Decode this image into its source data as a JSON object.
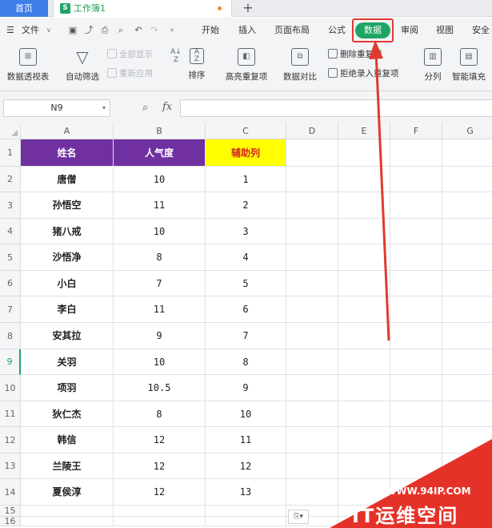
{
  "tabs": {
    "home": "首页",
    "workbook": "工作簿1",
    "new_tab": "+"
  },
  "menu": {
    "file": "文件",
    "items": [
      "开始",
      "插入",
      "页面布局",
      "公式",
      "数据",
      "审阅",
      "视图",
      "安全"
    ]
  },
  "ribbon": {
    "pivot": "数据透视表",
    "autofilter": "自动筛选",
    "show_all": "全部显示",
    "reapply": "重新应用",
    "sort": "排序",
    "highlight_dup": "高亮重复项",
    "compare": "数据对比",
    "remove_dup": "删除重复项",
    "reject_dup": "拒绝录入重复项",
    "split": "分列",
    "smart_fill": "智能填充"
  },
  "formula_bar": {
    "name_box": "N9",
    "fx": "fx",
    "formula": ""
  },
  "columns": [
    "A",
    "B",
    "C",
    "D",
    "E",
    "F",
    "G"
  ],
  "rows": [
    "1",
    "2",
    "3",
    "4",
    "5",
    "6",
    "7",
    "8",
    "9",
    "10",
    "11",
    "12",
    "13",
    "14",
    "15",
    "16"
  ],
  "active_row": "9",
  "headers": [
    "姓名",
    "人气度",
    "辅助列"
  ],
  "table": [
    [
      "唐僧",
      "10",
      "1"
    ],
    [
      "孙悟空",
      "11",
      "2"
    ],
    [
      "猪八戒",
      "10",
      "3"
    ],
    [
      "沙悟净",
      "8",
      "4"
    ],
    [
      "小白",
      "7",
      "5"
    ],
    [
      "李白",
      "11",
      "6"
    ],
    [
      "安其拉",
      "9",
      "7"
    ],
    [
      "关羽",
      "10",
      "8"
    ],
    [
      "项羽",
      "10.5",
      "9"
    ],
    [
      "狄仁杰",
      "8",
      "10"
    ],
    [
      "韩信",
      "12",
      "11"
    ],
    [
      "兰陵王",
      "12",
      "12"
    ],
    [
      "夏侯淳",
      "12",
      "13"
    ]
  ],
  "watermark": {
    "url": "WWW.94IP.COM",
    "brand": "IT运维空间"
  },
  "colors": {
    "header_purple": "#7030a0",
    "helper_yellow": "#ffff00",
    "accent_green": "#1fa463",
    "annotation_red": "#e03a2f"
  }
}
